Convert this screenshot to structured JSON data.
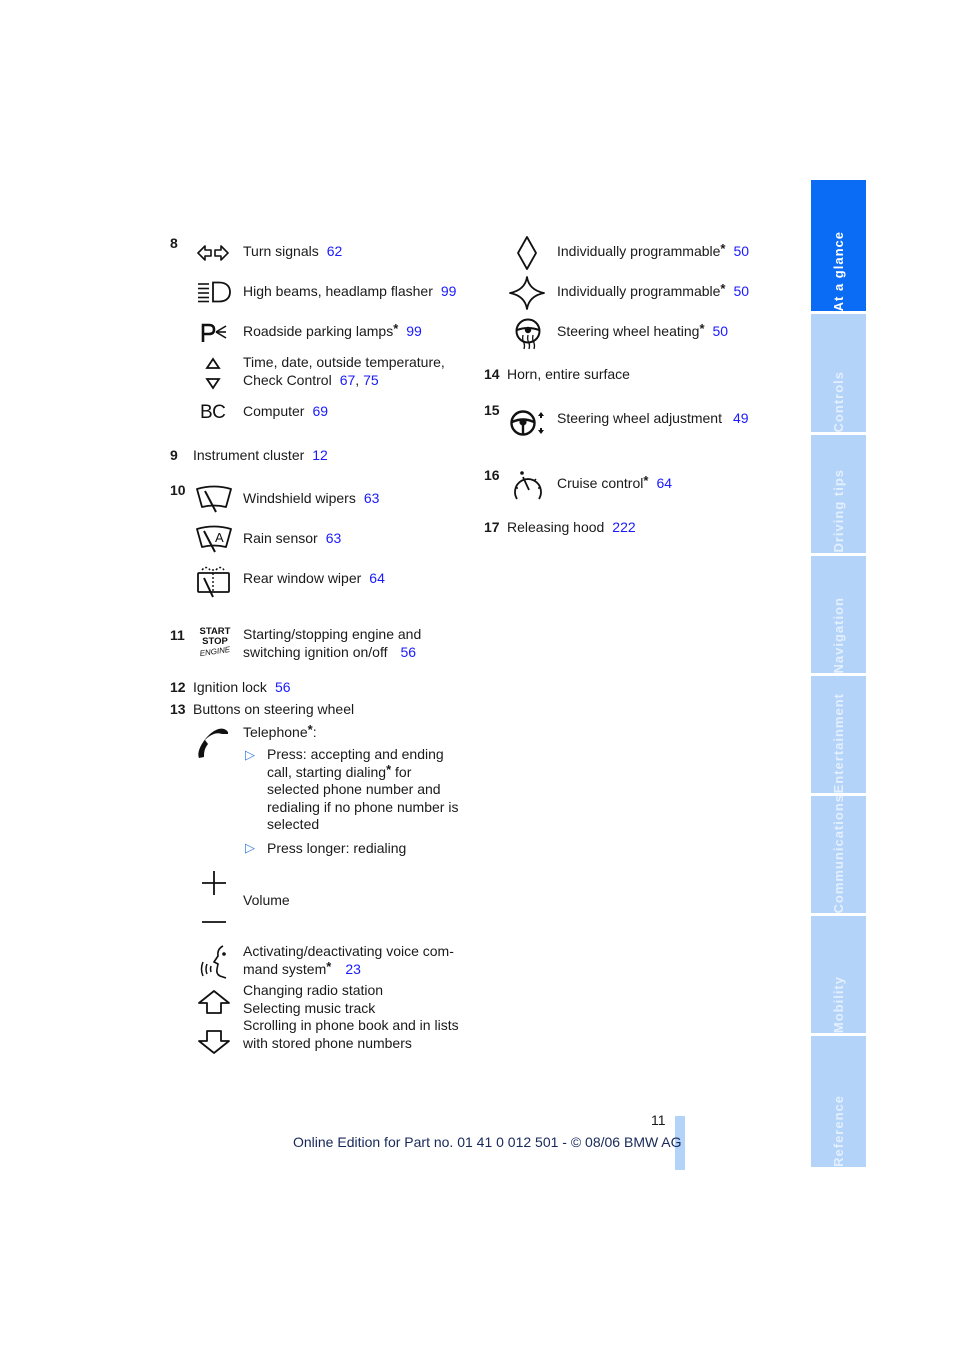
{
  "sections": {
    "s8": {
      "number": "8",
      "items": [
        {
          "icon": "turn-signals-icon",
          "label": "Turn signals",
          "refs": [
            "62"
          ]
        },
        {
          "icon": "high-beams-icon",
          "label": "High beams, headlamp flasher",
          "refs": [
            "99"
          ]
        },
        {
          "icon": "parking-lamps-icon",
          "label": "Roadside parking lamps",
          "asterisk": "*",
          "refs": [
            "99"
          ]
        },
        {
          "icon": "up-down-triangle-icon",
          "label_line1": "Time, date, outside temperature,",
          "label_line2": "Check Control",
          "refs": [
            "67",
            "75"
          ],
          "ref_sep": ","
        },
        {
          "icon": "bc-computer-icon",
          "icon_text": "BC",
          "label": "Computer",
          "refs": [
            "69"
          ]
        }
      ]
    },
    "s9": {
      "number": "9",
      "label": "Instrument cluster",
      "refs": [
        "12"
      ]
    },
    "s10": {
      "number": "10",
      "items": [
        {
          "icon": "windshield-wiper-icon",
          "label": "Windshield wipers",
          "refs": [
            "63"
          ]
        },
        {
          "icon": "rain-sensor-icon",
          "icon_text": "A",
          "label": "Rain sensor",
          "refs": [
            "63"
          ]
        },
        {
          "icon": "rear-window-wiper-icon",
          "label": "Rear window wiper",
          "refs": [
            "64"
          ]
        }
      ]
    },
    "s11": {
      "number": "11",
      "icon_text": [
        "START",
        "STOP",
        "ENGINE"
      ],
      "label_line1": "Starting/stopping engine and",
      "label_line2": "switching ignition on/off",
      "refs": [
        "56"
      ]
    },
    "s12": {
      "number": "12",
      "label": "Ignition lock",
      "refs": [
        "56"
      ]
    },
    "s13": {
      "number": "13",
      "label": "Buttons on steering wheel",
      "telephone": {
        "label": "Telephone",
        "asterisk": "*",
        "suffix": ":",
        "bullets": [
          {
            "lines": [
              "Press: accepting and ending",
              "call, starting dialing",
              "selected phone number and",
              "redialing if no phone number is",
              "selected"
            ],
            "asterisk_after_line": 1,
            "line2_suffix": " for"
          },
          {
            "lines": [
              "Press longer: redialing"
            ]
          }
        ]
      },
      "volume": {
        "label": "Volume"
      },
      "voice": {
        "line1": "Activating/deactivating voice com-",
        "line2": "mand system",
        "asterisk": "*",
        "refs": [
          "23"
        ]
      },
      "arrows": {
        "lines": [
          "Changing radio station",
          "Selecting music track",
          "Scrolling in phone book and in lists",
          "with stored phone numbers"
        ]
      }
    },
    "s13_right": {
      "items": [
        {
          "icon": "diamond-icon",
          "label": "Individually programmable",
          "asterisk": "*",
          "refs": [
            "50"
          ]
        },
        {
          "icon": "star-diamond-icon",
          "label": "Individually programmable",
          "asterisk": "*",
          "refs": [
            "50"
          ]
        },
        {
          "icon": "steering-wheel-heating-icon",
          "label": "Steering wheel heating",
          "asterisk": "*",
          "refs": [
            "50"
          ]
        }
      ]
    },
    "s14": {
      "number": "14",
      "label": "Horn, entire surface"
    },
    "s15": {
      "number": "15",
      "label": "Steering wheel adjustment",
      "refs": [
        "49"
      ]
    },
    "s16": {
      "number": "16",
      "label": "Cruise control",
      "asterisk": "*",
      "refs": [
        "64"
      ]
    },
    "s17": {
      "number": "17",
      "label": "Releasing hood",
      "refs": [
        "222"
      ]
    }
  },
  "sidebar": {
    "tabs": [
      {
        "label": "At a glance",
        "active": true
      },
      {
        "label": "Controls",
        "active": false
      },
      {
        "label": "Driving tips",
        "active": false
      },
      {
        "label": "Navigation",
        "active": false
      },
      {
        "label": "Entertainment",
        "active": false
      },
      {
        "label": "Communications",
        "active": false
      },
      {
        "label": "Mobility",
        "active": false
      },
      {
        "label": "Reference",
        "active": false
      }
    ]
  },
  "footer": {
    "page_number": "11",
    "edition_text": "Online Edition for Part no. 01 41 0 012 501 - © 08/06 BMW AG"
  },
  "colors": {
    "link": "#1a1aff",
    "tab_active": "#0a6bf5",
    "tab_inactive": "#b3d3f8",
    "bullet": "#3a7fe0"
  }
}
